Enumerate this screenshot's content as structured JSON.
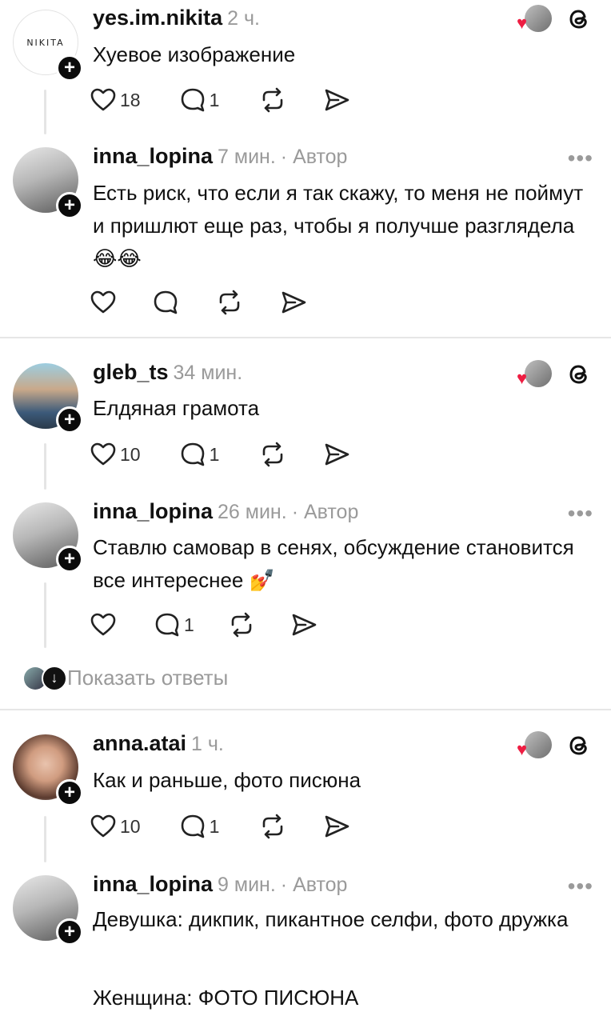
{
  "posts": [
    {
      "username": "yes.im.nikita",
      "time": "2 ч.",
      "avatar_text": "NIKITA",
      "text": "Хуевое изображение",
      "likes": "18",
      "replies": "1"
    },
    {
      "username": "inna_lopina",
      "time": "7 мин.",
      "author": "· Автор",
      "text": "Есть риск, что  если я так скажу, то меня не поймут и  пришлют еще раз, чтобы я получше разглядела 😂😂"
    },
    {
      "username": "gleb_ts",
      "time": "34 мин.",
      "text": "Елдяная грамота",
      "likes": "10",
      "replies": "1"
    },
    {
      "username": "inna_lopina",
      "time": "26 мин.",
      "author": "· Автор",
      "text": "Ставлю самовар в сенях, обсуждение становится все интереснее 💅",
      "replies": "1"
    },
    {
      "username": "anna.atai",
      "time": "1 ч.",
      "text": "Как и раньше, фото писюна",
      "likes": "10",
      "replies": "1"
    },
    {
      "username": "inna_lopina",
      "time": "9 мин.",
      "author": "· Автор",
      "text_line1": "Девушка: дикпик, пикантное селфи, фото дружка",
      "text_line2": "Женщина: ФОТО ПИСЮНА"
    }
  ],
  "show_replies": "Показать ответы",
  "icons": [
    "heart-icon",
    "comment-icon",
    "repost-icon",
    "share-icon",
    "threads-icon",
    "more-icon",
    "plus-icon",
    "arrow-down-icon"
  ],
  "colors": {
    "accent_like": "#ee1d42",
    "muted": "#9a9a9a",
    "text": "#111111"
  }
}
